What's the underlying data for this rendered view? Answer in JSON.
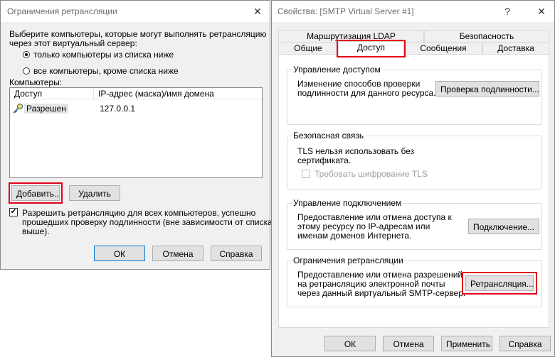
{
  "relay_dialog": {
    "title": "Ограничения ретрансляции",
    "close_glyph": "✕",
    "intro_line1": "Выберите компьютеры, которые могут выполнять ретрансляцию",
    "intro_line2": "через этот виртуальный сервер:",
    "radio_only_list": "только компьютеры из списка ниже",
    "radio_all_except": "все компьютеры, кроме списка ниже",
    "computers_label": "Компьютеры:",
    "columns": [
      "Доступ",
      "IP-адрес (маска)/имя домена"
    ],
    "rows": [
      {
        "access": "Разрешен",
        "ip": "127.0.0.1"
      }
    ],
    "add_button": "Добавить...",
    "remove_button": "Удалить",
    "allow_auth_line1": "Разрешить ретрансляцию для всех компьютеров, успешно",
    "allow_auth_line2": "прошедших проверку подлинности (вне зависимости от списка",
    "allow_auth_line3": "выше).",
    "allow_auth_checked": true,
    "ok": "ОК",
    "cancel": "Отмена",
    "help": "Справка"
  },
  "props_dialog": {
    "title": "Свойства: [SMTP Virtual Server #1]",
    "help_glyph": "?",
    "close_glyph": "✕",
    "tabs_row1": [
      "Маршрутизация LDAP",
      "Безопасность"
    ],
    "tabs_row2": [
      "Общие",
      "Доступ",
      "Сообщения",
      "Доставка"
    ],
    "active_tab": "Доступ",
    "groups": {
      "access_control": {
        "title": "Управление доступом",
        "text1": "Изменение способов проверки",
        "text2": "подлинности для данного ресурса.",
        "button": "Проверка подлинности..."
      },
      "secure": {
        "title": "Безопасная связь",
        "text1": "TLS нельзя использовать без",
        "text2": "сертификата.",
        "checkbox": "Требовать шифрование TLS"
      },
      "connection": {
        "title": "Управление подключением",
        "text1": "Предоставление или отмена доступа к",
        "text2": "этому ресурсу по IP-адресам или",
        "text3": "именам доменов Интернета.",
        "button": "Подключение..."
      },
      "relay": {
        "title": "Ограничения ретрансляции",
        "text1": "Предоставление или отмена разрешений",
        "text2": "на ретрансляцию электронной почты",
        "text3": "через данный виртуальный SMTP-сервер.",
        "button": "Ретрансляция..."
      }
    },
    "ok": "ОК",
    "cancel": "Отмена",
    "apply": "Применить",
    "help": "Справка"
  },
  "colors": {
    "highlight": "#e3001b",
    "dialog_bg": "#f0f0f0",
    "button_bg": "#e1e1e1"
  }
}
